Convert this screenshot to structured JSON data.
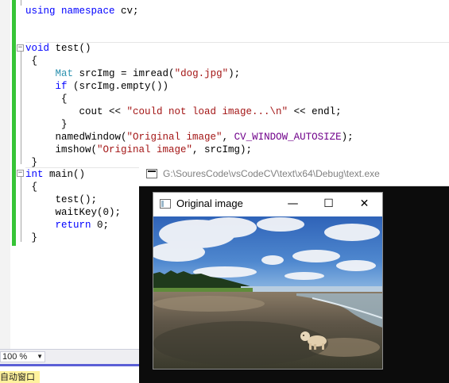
{
  "editor": {
    "lines": [
      {
        "id": "l1",
        "tokens": [
          {
            "t": "using",
            "c": "kw"
          },
          {
            "t": " "
          },
          {
            "t": "namespace",
            "c": "kw"
          },
          {
            "t": " cv;"
          }
        ]
      },
      {
        "id": "l2",
        "tokens": [
          {
            "t": "void",
            "c": "kw"
          },
          {
            "t": " test()"
          }
        ]
      },
      {
        "id": "l3",
        "tokens": [
          {
            "t": " {"
          }
        ]
      },
      {
        "id": "l4",
        "tokens": [
          {
            "t": "     "
          },
          {
            "t": "Mat",
            "c": "ty"
          },
          {
            "t": " srcImg = imread("
          },
          {
            "t": "\"dog.jpg\"",
            "c": "st"
          },
          {
            "t": ");"
          }
        ]
      },
      {
        "id": "l5",
        "tokens": [
          {
            "t": "     "
          },
          {
            "t": "if",
            "c": "kw"
          },
          {
            "t": " (srcImg.empty())"
          }
        ]
      },
      {
        "id": "l6",
        "tokens": [
          {
            "t": "      {"
          }
        ]
      },
      {
        "id": "l7",
        "tokens": [
          {
            "t": "         cout << "
          },
          {
            "t": "\"could not load image...\\n\"",
            "c": "st"
          },
          {
            "t": " << endl;"
          }
        ]
      },
      {
        "id": "l8",
        "tokens": [
          {
            "t": "      }"
          }
        ]
      },
      {
        "id": "l9",
        "tokens": [
          {
            "t": "     namedWindow("
          },
          {
            "t": "\"Original image\"",
            "c": "st"
          },
          {
            "t": ", "
          },
          {
            "t": "CV_WINDOW_AUTOSIZE",
            "c": "mac"
          },
          {
            "t": ");"
          }
        ]
      },
      {
        "id": "l10",
        "tokens": [
          {
            "t": "     imshow("
          },
          {
            "t": "\"Original image\"",
            "c": "st"
          },
          {
            "t": ", srcImg);"
          }
        ]
      },
      {
        "id": "l11",
        "tokens": [
          {
            "t": " }"
          }
        ]
      },
      {
        "id": "l12",
        "tokens": [
          {
            "t": "int",
            "c": "kw"
          },
          {
            "t": " main()"
          }
        ]
      },
      {
        "id": "l13",
        "tokens": [
          {
            "t": " {"
          }
        ]
      },
      {
        "id": "l14",
        "tokens": [
          {
            "t": "     test();"
          }
        ]
      },
      {
        "id": "l15",
        "tokens": [
          {
            "t": "     waitKey(0);"
          }
        ]
      },
      {
        "id": "l16",
        "tokens": [
          {
            "t": "     "
          },
          {
            "t": "return",
            "c": "kw"
          },
          {
            "t": " 0;"
          }
        ]
      },
      {
        "id": "l17",
        "tokens": [
          {
            "t": " }"
          }
        ]
      }
    ]
  },
  "statusbar": {
    "zoom_value": "100 %",
    "autos_panel_label": "自动窗口"
  },
  "console_window": {
    "title": "G:\\SouresCode\\vsCodeCV\\text\\x64\\Debug\\text.exe"
  },
  "image_window": {
    "title": "Original image",
    "minimize_glyph": "—",
    "maximize_glyph": "☐",
    "close_glyph": "✕"
  },
  "colors": {
    "keyword": "#0000ff",
    "type": "#2b91af",
    "string": "#a31515",
    "macro": "#6f008a",
    "change_bar": "#37c437"
  }
}
